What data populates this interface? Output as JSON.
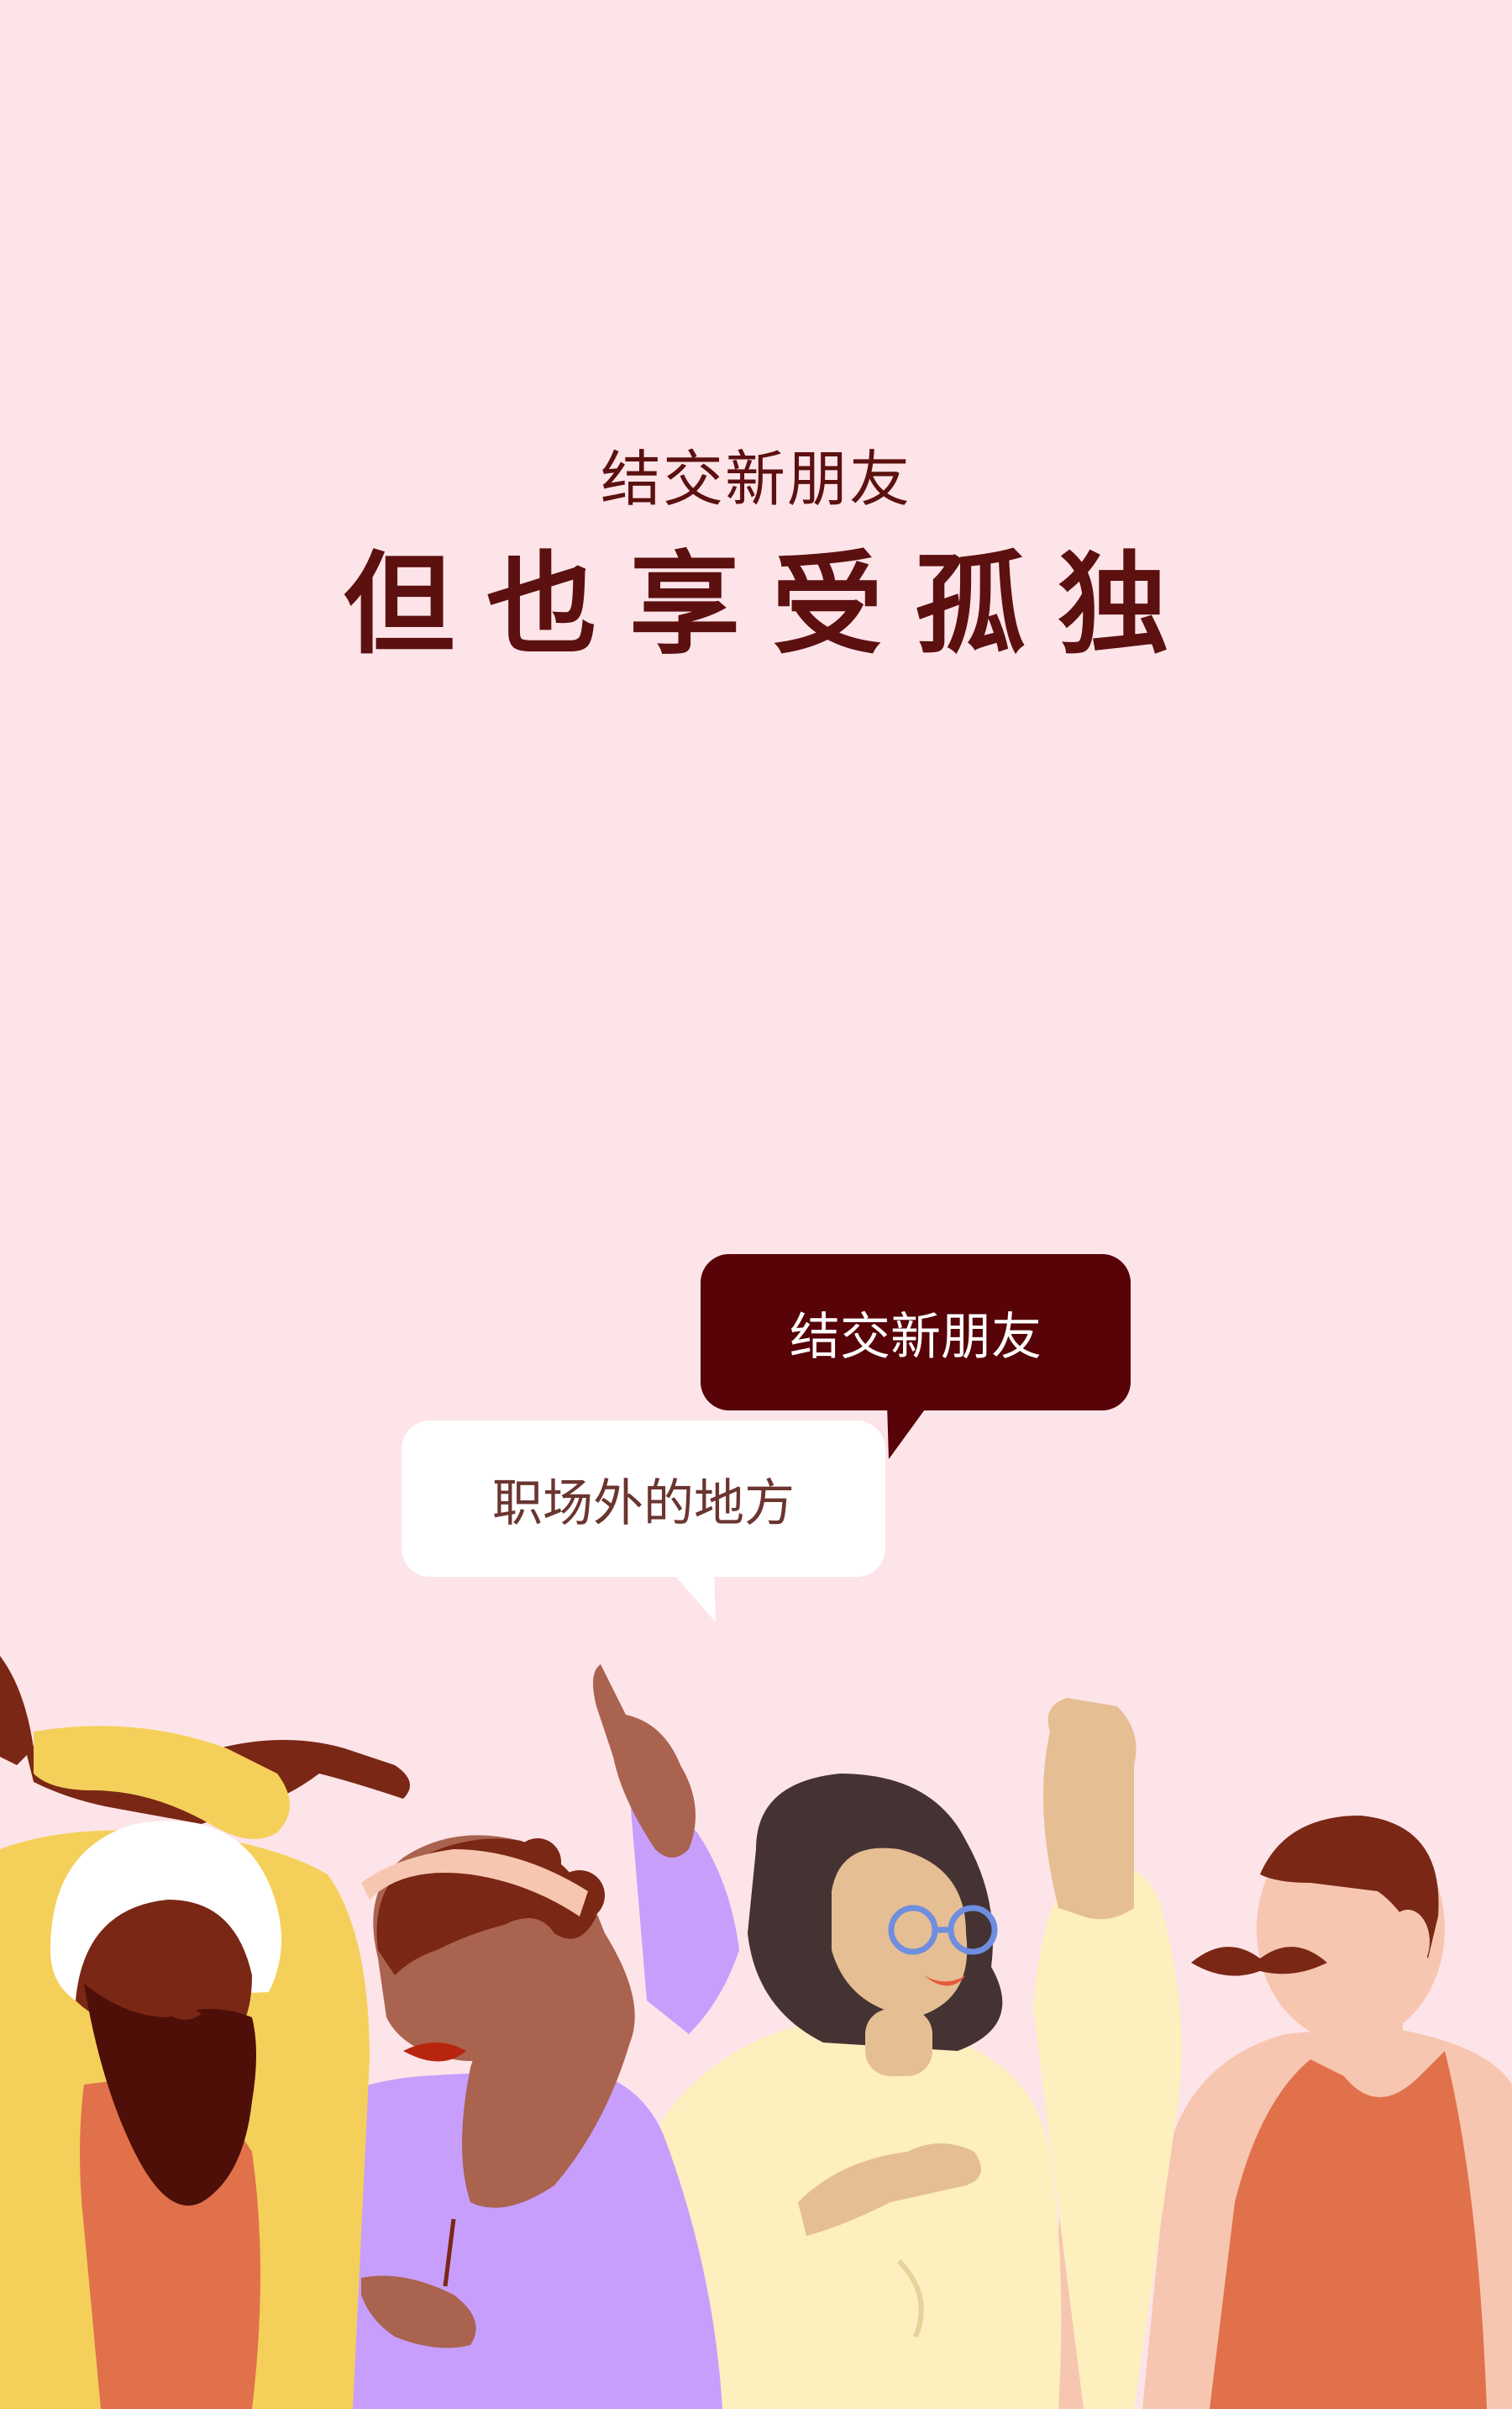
{
  "hero": {
    "subtitle": "结交新朋友",
    "title": "但也享受孤独"
  },
  "bubbles": {
    "dark_text": "结交新朋友",
    "light_text": "职场外的地方"
  },
  "colors": {
    "background": "#fde4e8",
    "heading": "#5c1010",
    "bubble_dark": "#570307",
    "bubble_light": "#ffffff"
  },
  "illustration": {
    "name": "group-of-people-illustration"
  }
}
